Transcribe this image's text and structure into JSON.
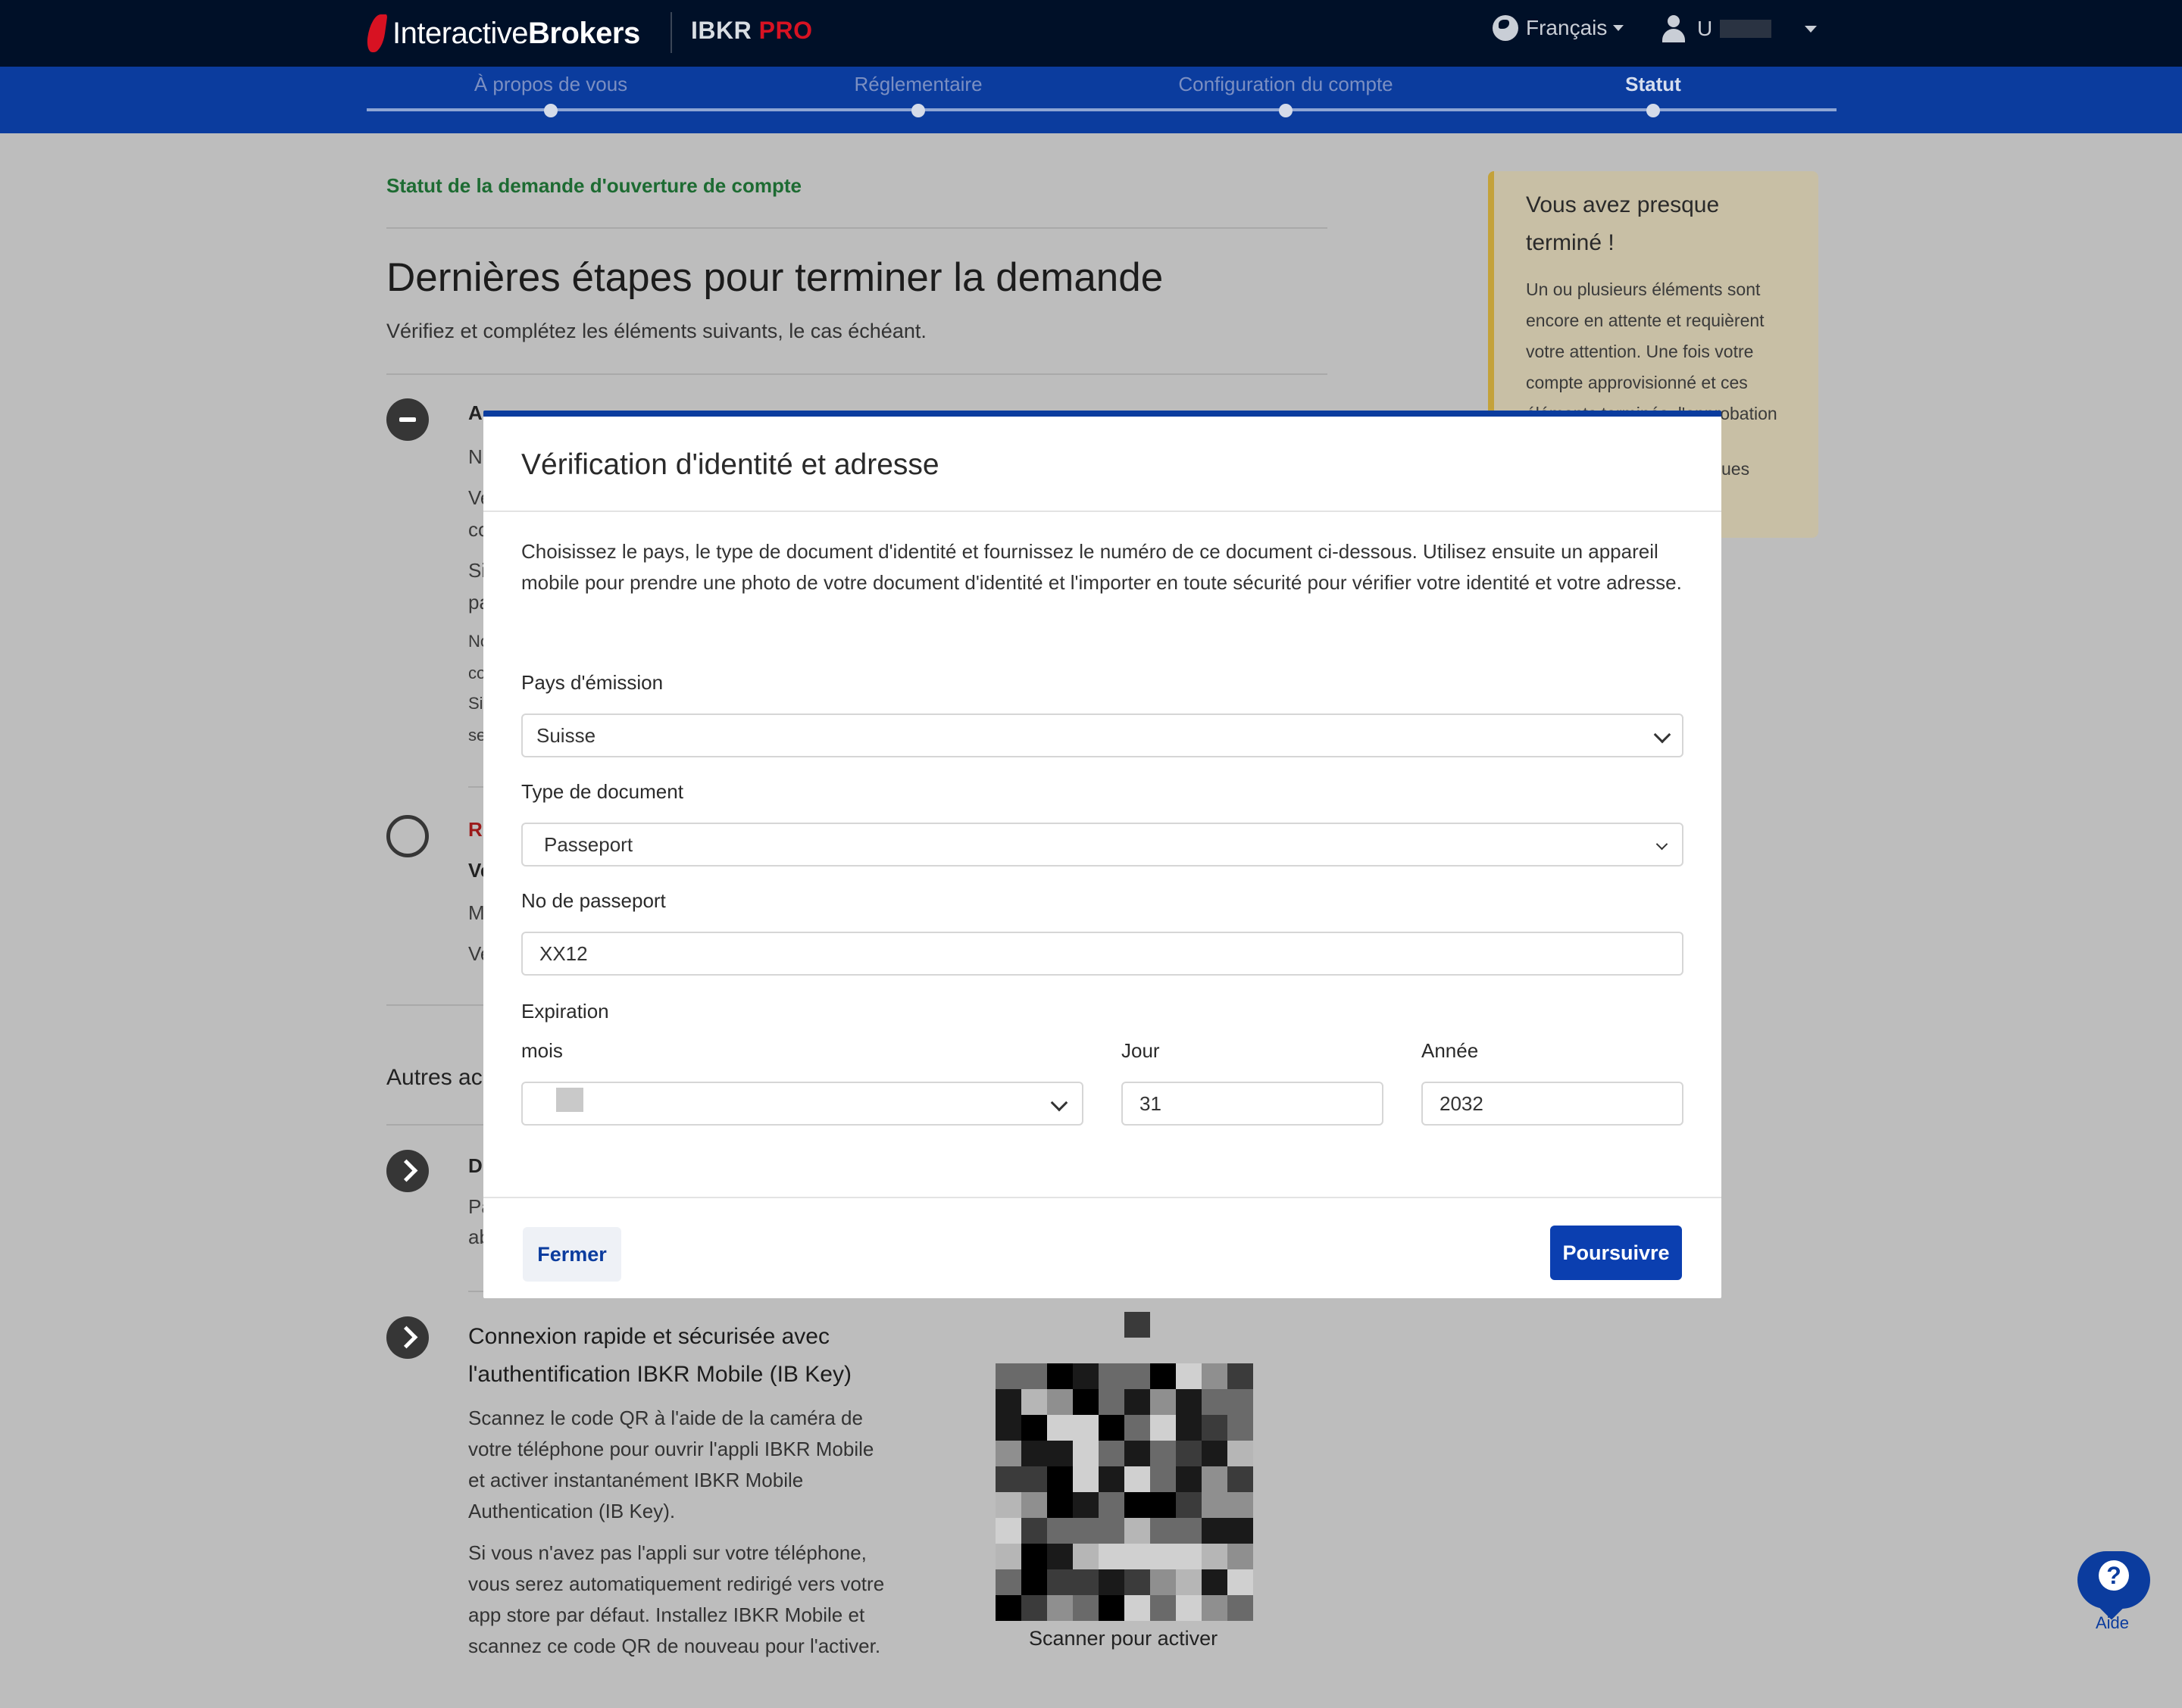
{
  "header": {
    "brand_regular": "Interactive",
    "brand_bold": "Brokers",
    "product": "IBKR",
    "product_pro": "PRO",
    "language": "Français",
    "user_initial": "U"
  },
  "stepper": {
    "steps": [
      {
        "label": "À propos de vous"
      },
      {
        "label": "Réglementaire"
      },
      {
        "label": "Configuration du compte"
      },
      {
        "label": "Statut"
      }
    ],
    "active_index": 3
  },
  "page": {
    "status_link": "Statut de la demande d'ouverture de compte",
    "title": "Dernières étapes pour terminer la demande",
    "subtitle": "Vérifiez et complétez les éléments suivants, le cas échéant.",
    "fragments": [
      "A",
      "N",
      "Ve",
      "co",
      "Si",
      "pa",
      "No",
      "co",
      "Si",
      "se"
    ],
    "fragments2": [
      "R",
      "Ve",
      "M",
      "Ve"
    ],
    "autres": "Autres ac",
    "fragments3": [
      "D",
      "Pa",
      "ab"
    ],
    "ibkey_title": "Connexion rapide et sécurisée avec l'authentification IBKR Mobile (IB Key)",
    "ibkey_p1": "Scannez le code QR à l'aide de la caméra de votre téléphone pour ouvrir l'appli IBKR Mobile et activer instantanément IBKR Mobile Authentication (IB Key).",
    "ibkey_p2": "Si vous n'avez pas l'appli sur votre téléphone, vous serez automatiquement redirigé vers votre app store par défaut. Installez IBKR Mobile et scannez ce code QR de nouveau pour l'activer.",
    "qr_caption": "Scanner pour activer"
  },
  "info_card": {
    "title": "Vous avez presque terminé !",
    "text": "Un ou plusieurs éléments sont encore en attente et requièrent votre attention. Une fois votre compte approvisionné et ces éléments terminés, l'approbation",
    "tail": "ues"
  },
  "help": {
    "label": "Aide"
  },
  "modal": {
    "title": "Vérification d'identité et adresse",
    "description": "Choisissez le pays, le type de document d'identité et fournissez le numéro de ce document ci-dessous. Utilisez ensuite un appareil mobile pour prendre une photo de votre document d'identité et l'importer en toute sécurité pour vérifier votre identité et votre adresse.",
    "country_label": "Pays d'émission",
    "country_value": "Suisse",
    "doc_type_label": "Type de document",
    "doc_type_value": "Passeport",
    "passport_label": "No de passeport",
    "passport_value": "XX12",
    "expiration_label": "Expiration",
    "month_label": "mois",
    "day_label": "Jour",
    "day_value": "31",
    "year_label": "Année",
    "year_value": "2032",
    "close_label": "Fermer",
    "continue_label": "Poursuivre"
  },
  "colors": {
    "navy": "#001028",
    "brand_blue": "#0b3c9e",
    "brand_red": "#d81222",
    "status_green": "#1d6b32"
  }
}
